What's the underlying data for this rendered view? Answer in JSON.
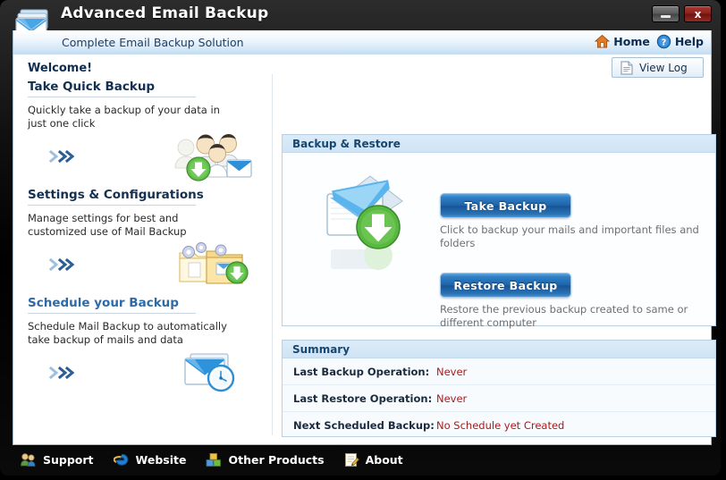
{
  "window": {
    "title": "Advanced Email Backup",
    "subtitle": "Complete Email Backup Solution",
    "minimize_label": "",
    "close_label": "x"
  },
  "header": {
    "home_label": "Home",
    "help_label": "Help"
  },
  "client": {
    "welcome_label": "Welcome!",
    "view_log_label": "View Log"
  },
  "left_sections": [
    {
      "title": "Take Quick Backup",
      "description": "Quickly take a backup of your data in just one click",
      "icon": "users-backup-icon",
      "is_link": false
    },
    {
      "title": "Settings & Configurations",
      "description": "Manage settings for best and customized use of Mail Backup",
      "icon": "folder-gears-icon",
      "is_link": false
    },
    {
      "title": "Schedule your Backup",
      "description": "Schedule Mail Backup to automatically take backup of mails and data",
      "icon": "envelope-clock-icon",
      "is_link": true
    }
  ],
  "backup_panel": {
    "header": "Backup & Restore",
    "icon": "envelope-download-icon",
    "take_backup_label": "Take Backup",
    "take_backup_caption": "Click to backup your mails and important files and folders",
    "restore_backup_label": "Restore Backup",
    "restore_backup_caption": "Restore the previous backup created to same or different computer"
  },
  "summary_panel": {
    "header": "Summary",
    "rows": [
      {
        "label": "Last Backup Operation:",
        "value": "Never"
      },
      {
        "label": "Last Restore Operation:",
        "value": "Never"
      },
      {
        "label": "Next Scheduled Backup:",
        "value": "No Schedule yet Created"
      }
    ]
  },
  "bottom_bar": {
    "items": [
      {
        "label": "Support",
        "icon": "support-people-icon"
      },
      {
        "label": "Website",
        "icon": "internet-explorer-icon"
      },
      {
        "label": "Other Products",
        "icon": "products-boxes-icon"
      },
      {
        "label": "About",
        "icon": "about-pencil-note-icon"
      }
    ]
  },
  "colors": {
    "accent_blue": "#1d63aa",
    "header_blue": "#18466f",
    "status_red": "#a02020",
    "link_blue": "#2f6aa8"
  }
}
